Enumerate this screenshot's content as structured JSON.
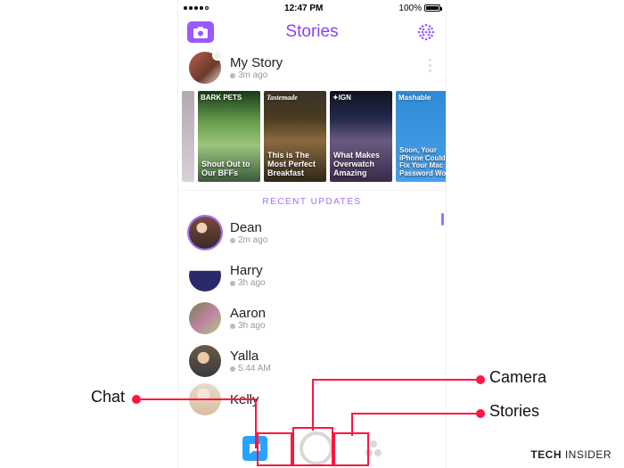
{
  "statusbar": {
    "time": "12:47 PM",
    "battery_label": "100%"
  },
  "header": {
    "title": "Stories"
  },
  "mystory": {
    "name": "My Story",
    "sub": "3m ago"
  },
  "discover": [
    {
      "brand": "BARK PETS",
      "caption": "Shout Out to Our BFFs"
    },
    {
      "brand": "Tastemade",
      "caption": "This is The Most Perfect Breakfast"
    },
    {
      "brand": "✦IGN",
      "caption": "What Makes Overwatch Amazing"
    },
    {
      "brand": "Mashable",
      "caption": "Soon, Your iPhone Could Fix Your Mac Password Woes"
    }
  ],
  "recent_label": "RECENT UPDATES",
  "friends": [
    {
      "name": "Dean",
      "sub": "2m ago"
    },
    {
      "name": "Harry",
      "sub": "3h ago"
    },
    {
      "name": "Aaron",
      "sub": "3h ago"
    },
    {
      "name": "Yalla",
      "sub": "5:44 AM"
    },
    {
      "name": "Kelly",
      "sub": ""
    }
  ],
  "annotations": {
    "chat": "Chat",
    "camera": "Camera",
    "stories": "Stories"
  },
  "watermark_bold": "TECH",
  "watermark_rest": " INSIDER"
}
